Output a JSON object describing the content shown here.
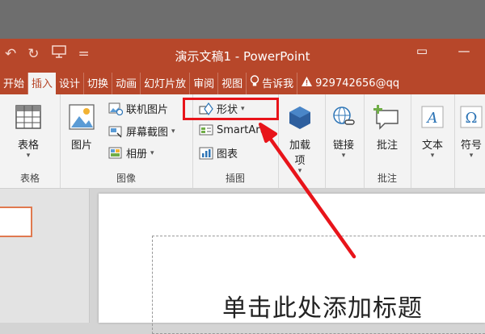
{
  "window": {
    "title": "演示文稿1 - PowerPoint",
    "controls": [
      "▭",
      "—"
    ]
  },
  "quick_access": {
    "undo_icon": "undo-icon",
    "redo_icon": "redo-icon",
    "present_icon": "present-icon",
    "customize": "="
  },
  "tabs": [
    {
      "label": "开始"
    },
    {
      "label": "插入",
      "active": true
    },
    {
      "label": "设计"
    },
    {
      "label": "切换"
    },
    {
      "label": "动画"
    },
    {
      "label": "幻灯片放"
    },
    {
      "label": "审阅"
    },
    {
      "label": "视图"
    }
  ],
  "tell_me": "告诉我",
  "account": "929742656@qq",
  "ribbon": {
    "tables": {
      "table_label": "表格",
      "group_label": "表格"
    },
    "images": {
      "pictures_label": "图片",
      "online_pictures_label": "联机图片",
      "screenshot_label": "屏幕截图",
      "album_label": "相册",
      "group_label": "图像"
    },
    "illustrations": {
      "shapes_label": "形状",
      "smartart_label": "SmartArt",
      "chart_label": "图表",
      "group_label": "插图"
    },
    "addins": {
      "label_line1": "加载",
      "label_line2": "项"
    },
    "links": {
      "label": "链接"
    },
    "comments": {
      "comment_label": "批注",
      "group_label": "批注"
    },
    "text": {
      "label": "文本"
    },
    "symbols": {
      "label": "符号"
    }
  },
  "slide": {
    "title_placeholder": "单击此处添加标题"
  },
  "colors": {
    "accent": "#b7472a",
    "highlight": "#e8141a"
  }
}
